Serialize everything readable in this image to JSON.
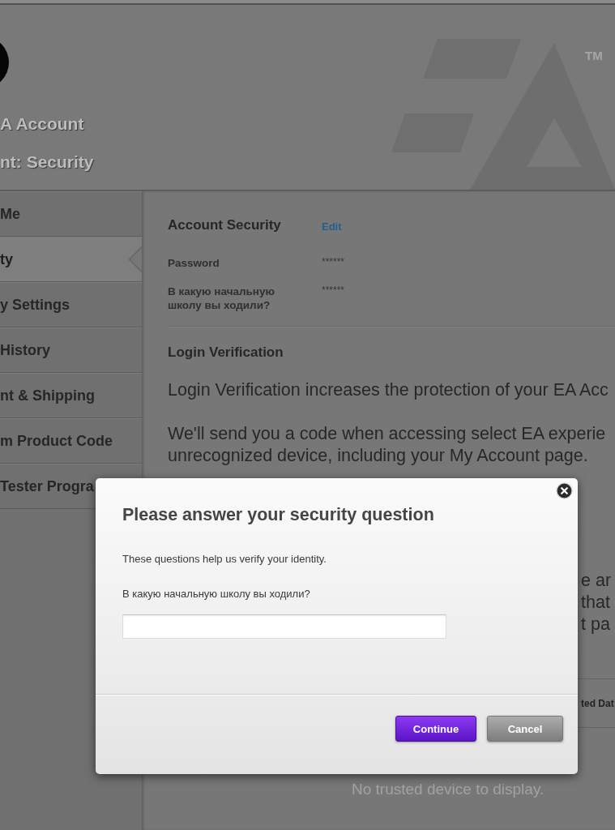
{
  "header": {
    "titles": [
      "A Account",
      "nt: Security"
    ],
    "trademark": "TM"
  },
  "sidebar": {
    "items": [
      {
        "label": "Me",
        "selected": false
      },
      {
        "label": "ty",
        "selected": true
      },
      {
        "label": "y Settings",
        "selected": false
      },
      {
        "label": "History",
        "selected": false
      },
      {
        "label": "nt & Shipping",
        "selected": false
      },
      {
        "label": "m Product Code",
        "selected": false
      },
      {
        "label": "Tester Progra",
        "selected": false
      }
    ]
  },
  "account_security": {
    "title": "Account Security",
    "edit_link": "Edit",
    "fields": [
      {
        "label": "Password",
        "value": "******"
      },
      {
        "label": "В какую начальную школу вы ходили?",
        "value": "******"
      }
    ]
  },
  "login_verification": {
    "title": "Login Verification",
    "paragraphs": [
      {
        "lines": [
          "Login Verification increases the protection of your EA Acc"
        ]
      },
      {
        "lines": [
          "We'll send you a code when accessing select EA experie",
          "unrecognized device, including your My Account page."
        ]
      }
    ],
    "covered_paragraph": {
      "lines": [
        "e ar",
        "that",
        "t pa"
      ]
    }
  },
  "trusted_devices": {
    "column_header": "ted Dat",
    "empty_message": "No trusted device to display."
  },
  "dialog": {
    "title": "Please answer your security question",
    "description": "These questions help us verify your identity.",
    "question": "В какую начальную школу вы ходили?",
    "buttons": [
      {
        "label": "Continue",
        "kind": "primary"
      },
      {
        "label": "Cancel",
        "kind": "secondary"
      }
    ]
  }
}
